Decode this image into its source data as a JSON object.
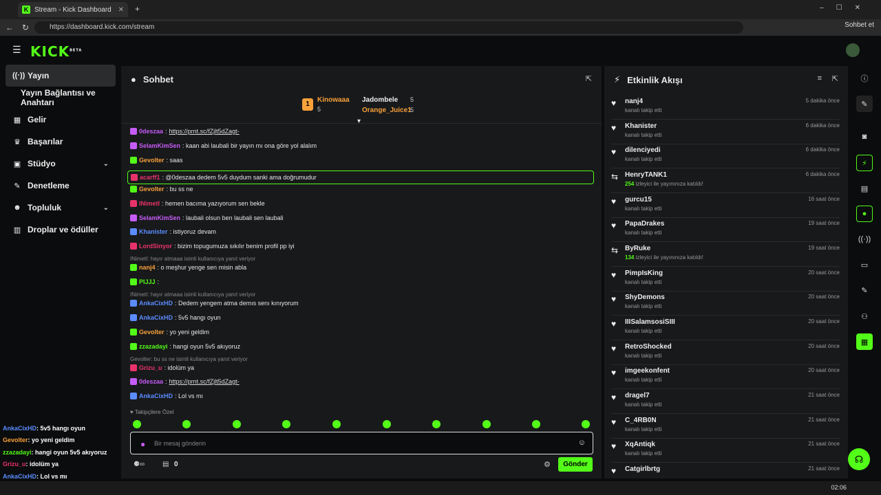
{
  "browser": {
    "tab_title": "Stream - Kick Dashboard",
    "url": "https://dashboard.kick.com/stream",
    "copilot_label": "Sohbet et"
  },
  "logo": {
    "text": "KICK",
    "beta": "BETA"
  },
  "sidebar": {
    "items": [
      {
        "label": "Yayın",
        "icon": "broadcast-icon"
      },
      {
        "label": "Yayın Bağlantısı ve Anahtarı",
        "icon": ""
      },
      {
        "label": "Gelir",
        "icon": "chart-icon"
      },
      {
        "label": "Başarılar",
        "icon": "trophy-icon"
      },
      {
        "label": "Stüdyo",
        "icon": "studio-icon"
      },
      {
        "label": "Denetleme",
        "icon": "wrench-icon"
      },
      {
        "label": "Topluluk",
        "icon": "users-icon"
      },
      {
        "label": "Droplar ve ödüller",
        "icon": "gift-icon"
      }
    ]
  },
  "chat": {
    "title": "Sohbet",
    "leaderboard": [
      {
        "name": "Kinowaaa",
        "count": "5"
      },
      {
        "name": "Jadombele",
        "count": "5"
      },
      {
        "name": "Orange_Juice1",
        "count": "5"
      }
    ],
    "messages": [
      {
        "user": "0deszaa",
        "text": "https://prnt.sc/fZjlt5dZagt-",
        "color": "purple",
        "link": true
      },
      {
        "user": "SelamKimSen",
        "text": ": kaan abi laubali bir yayın mı ona göre yol alalım",
        "color": "purple"
      },
      {
        "user": "Gevolter",
        "text": ": saas",
        "color": "orange"
      },
      {
        "user": "acarff1",
        "text": ": @0deszaa dedem 5v5 duydum sanki ama doğrumudur",
        "color": "red"
      },
      {
        "user": "Gevolter",
        "text": ": bu ss ne",
        "color": "orange"
      },
      {
        "user": "INimetI",
        "text": ": hemen bacıma yazıyorum sen bekle",
        "color": "red"
      },
      {
        "user": "SelamKimSen",
        "text": ": laubali olsun ben laubali sen laubali",
        "color": "purple"
      },
      {
        "user": "Khanister",
        "text": ": istiyoruz devam",
        "color": "blue"
      },
      {
        "user": "LordSinyor",
        "text": ": bizim topugumuza sıkılır benim profil pp iyi",
        "color": "red"
      },
      {
        "reply": "INimetI: hayır atmaaa isimli kullanıcıya yanıt veriyor"
      },
      {
        "user": "nanj4",
        "text": ": o meşhur yenge sen misin abla",
        "color": "orange"
      },
      {
        "user": "PIJJJ",
        "text": ":",
        "color": "green"
      },
      {
        "reply": "INimetI: hayır atmaaa isimli kullanıcıya yanıt veriyor"
      },
      {
        "user": "AnkaCixHD",
        "text": ": Dedem yengem atma demıs senı kınıyorum",
        "color": "blue"
      },
      {
        "user": "AnkaCixHD",
        "text": ": 5v5 hangı oyun",
        "color": "blue"
      },
      {
        "user": "Gevolter",
        "text": ": yo yeni geldim",
        "color": "orange"
      },
      {
        "user": "zzazadayi",
        "text": ": hangi oyun 5v5 akıyoruz",
        "color": "green"
      },
      {
        "reply": "Gevolter: bu ss ne isimli kullanıcıya yanıt veriyor"
      },
      {
        "user": "Grizu_u",
        "text": ": idolüm ya",
        "color": "red"
      },
      {
        "user": "0deszaa",
        "text": "https://prnt.sc/fZjlt5dZagt-",
        "color": "purple",
        "link": true
      },
      {
        "user": "AnkaCixHD",
        "text": ": Lol vs mı",
        "color": "blue"
      }
    ],
    "followers_only": "Takipçilere Özel",
    "input_placeholder": "Bir mesaj gönderin",
    "send_label": "Gönder",
    "points": "0"
  },
  "activity": {
    "title": "Etkinlik Akışı",
    "items": [
      {
        "name": "nanj4",
        "desc": "kanalı takip etti",
        "time": "5 dakika önce"
      },
      {
        "name": "Khanister",
        "desc": "kanalı takip etti",
        "time": "6 dakika önce"
      },
      {
        "name": "dilenciyedi",
        "desc": "kanalı takip etti",
        "time": "6 dakika önce"
      },
      {
        "name": "HenryTANK1",
        "count": "254",
        "desc": " izleyici ile yayınınıza katıldı!",
        "time": "6 dakika önce",
        "raid": true
      },
      {
        "name": "gurcu15",
        "desc": "kanalı takip etti",
        "time": "16 saat önce"
      },
      {
        "name": "PapaDrakes",
        "desc": "kanalı takip etti",
        "time": "19 saat önce"
      },
      {
        "name": "ByRuke",
        "count": "134",
        "desc": " izleyici ile yayınınıza katıldı!",
        "time": "19 saat önce",
        "raid": true
      },
      {
        "name": "PimpIsKing",
        "desc": "kanalı takip etti",
        "time": "20 saat önce"
      },
      {
        "name": "ShyDemons",
        "desc": "kanalı takip etti",
        "time": "20 saat önce"
      },
      {
        "name": "IIISalamsosiSIII",
        "desc": "kanalı takip etti",
        "time": "20 saat önce"
      },
      {
        "name": "RetroShocked",
        "desc": "kanalı takip etti",
        "time": "20 saat önce"
      },
      {
        "name": "imgeekonfent",
        "desc": "kanalı takip etti",
        "time": "20 saat önce"
      },
      {
        "name": "dragel7",
        "desc": "kanalı takip etti",
        "time": "21 saat önce"
      },
      {
        "name": "C_4RB0N",
        "desc": "kanalı takip etti",
        "time": "21 saat önce"
      },
      {
        "name": "XqAntiqk",
        "desc": "kanalı takip etti",
        "time": "21 saat önce"
      },
      {
        "name": "Catgirlbrtg",
        "desc": "",
        "time": "21 saat önce"
      }
    ]
  },
  "overlay": [
    {
      "user": "AnkaCixHD",
      "text": ": 5v5 hangı oyun",
      "color": "blue"
    },
    {
      "user": "Gevolter",
      "text": ": yo yeni geldim",
      "color": "orange"
    },
    {
      "user": "zzazadayi",
      "text": ": hangi oyun 5v5 akıyoruz",
      "color": "green"
    },
    {
      "user": "Grizu_u",
      "text": ": idolüm ya",
      "color": "red"
    },
    {
      "user": "AnkaCixHD",
      "text": ": Lol vs mı",
      "color": "blue"
    },
    {
      "user": "0deszaa",
      "text": "https://prnt.sc/fZjlt5dZagt-",
      "color": "purple"
    }
  ],
  "taskbar": {
    "time": "02:06"
  }
}
